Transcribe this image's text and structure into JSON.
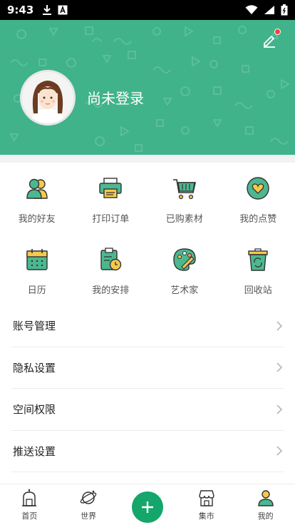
{
  "status_bar": {
    "time": "9:43",
    "icons": [
      "download-icon",
      "a-box-icon",
      "wifi-icon",
      "signal-icon",
      "battery-icon"
    ]
  },
  "header": {
    "login_text": "尚未登录",
    "bg_color": "#41b38b",
    "edit_icon": "pencil-icon",
    "notification_dot_color": "#ff3b3b"
  },
  "grid": {
    "items": [
      {
        "label": "我的好友",
        "icon": "friends-icon"
      },
      {
        "label": "打印订单",
        "icon": "printer-icon"
      },
      {
        "label": "已购素材",
        "icon": "cart-icon"
      },
      {
        "label": "我的点赞",
        "icon": "heart-icon"
      },
      {
        "label": "日历",
        "icon": "calendar-icon"
      },
      {
        "label": "我的安排",
        "icon": "schedule-icon"
      },
      {
        "label": "艺术家",
        "icon": "palette-icon"
      },
      {
        "label": "回收站",
        "icon": "recycle-bin-icon"
      }
    ]
  },
  "settings": {
    "items": [
      {
        "label": "账号管理"
      },
      {
        "label": "隐私设置"
      },
      {
        "label": "空间权限"
      },
      {
        "label": "推送设置"
      }
    ]
  },
  "bottom_nav": {
    "items": [
      {
        "label": "首页",
        "icon": "home-icon"
      },
      {
        "label": "世界",
        "icon": "planet-icon"
      },
      {
        "label": "",
        "icon": "plus-icon"
      },
      {
        "label": "集市",
        "icon": "shop-icon"
      },
      {
        "label": "我的",
        "icon": "user-icon"
      }
    ],
    "accent": "#14a66b"
  }
}
